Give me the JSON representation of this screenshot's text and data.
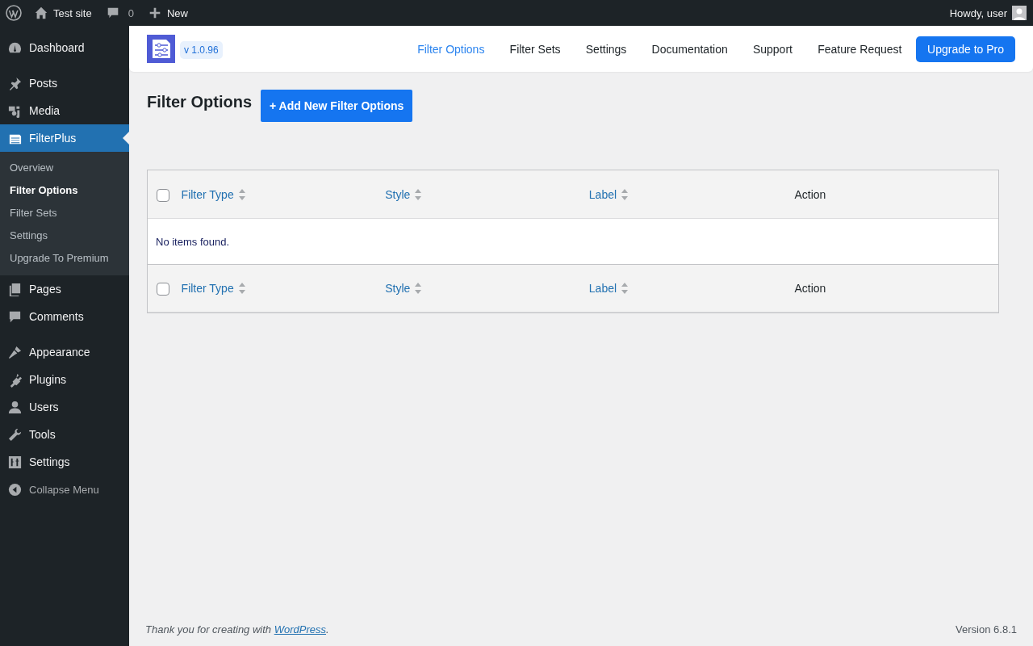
{
  "admin_bar": {
    "site": "Test site",
    "comments": "0",
    "new": "New",
    "greeting": "Howdy, user"
  },
  "sidebar": {
    "groups": [
      [
        {
          "label": "Dashboard",
          "selected": false
        }
      ],
      [
        {
          "label": "Posts",
          "selected": false
        },
        {
          "label": "Media",
          "selected": false
        },
        {
          "label": "FilterPlus",
          "selected": true,
          "children": [
            {
              "label": "Overview",
              "selected": false
            },
            {
              "label": "Filter Options",
              "selected": true
            },
            {
              "label": "Filter Sets",
              "selected": false
            },
            {
              "label": "Settings",
              "selected": false
            },
            {
              "label": "Upgrade To Premium",
              "selected": false
            }
          ]
        },
        {
          "label": "Pages",
          "selected": false
        },
        {
          "label": "Comments",
          "selected": false
        }
      ],
      [
        {
          "label": "Appearance",
          "selected": false
        },
        {
          "label": "Plugins",
          "selected": false
        },
        {
          "label": "Users",
          "selected": false
        },
        {
          "label": "Tools",
          "selected": false
        },
        {
          "label": "Settings",
          "selected": false
        }
      ]
    ],
    "collapse": "Collapse Menu"
  },
  "plugin_header": {
    "version": "v 1.0.96",
    "nav": [
      {
        "label": "Filter Options",
        "selected": true
      },
      {
        "label": "Filter Sets",
        "selected": false
      },
      {
        "label": "Settings",
        "selected": false
      },
      {
        "label": "Documentation",
        "selected": false
      },
      {
        "label": "Support",
        "selected": false
      },
      {
        "label": "Feature Request",
        "selected": false
      }
    ],
    "upgrade": "Upgrade to Pro"
  },
  "page": {
    "title": "Filter Options",
    "add_button": "+ Add New Filter Options"
  },
  "table": {
    "header": [
      {
        "label": "Filter Type",
        "sortable": true
      },
      {
        "label": "Style",
        "sortable": true
      },
      {
        "label": "Label",
        "sortable": true
      },
      {
        "label": "Action",
        "sortable": false
      }
    ],
    "header_checked": false,
    "empty_message": "No items found.",
    "footer": [
      {
        "label": "Filter Type",
        "sortable": true
      },
      {
        "label": "Style",
        "sortable": true
      },
      {
        "label": "Label",
        "sortable": true
      },
      {
        "label": "Action",
        "sortable": false
      }
    ],
    "footer_checked": false
  },
  "footer": {
    "thanks": "Thank you for creating with ",
    "link": "WordPress",
    "after": ".",
    "version": "Version 6.8.1"
  }
}
